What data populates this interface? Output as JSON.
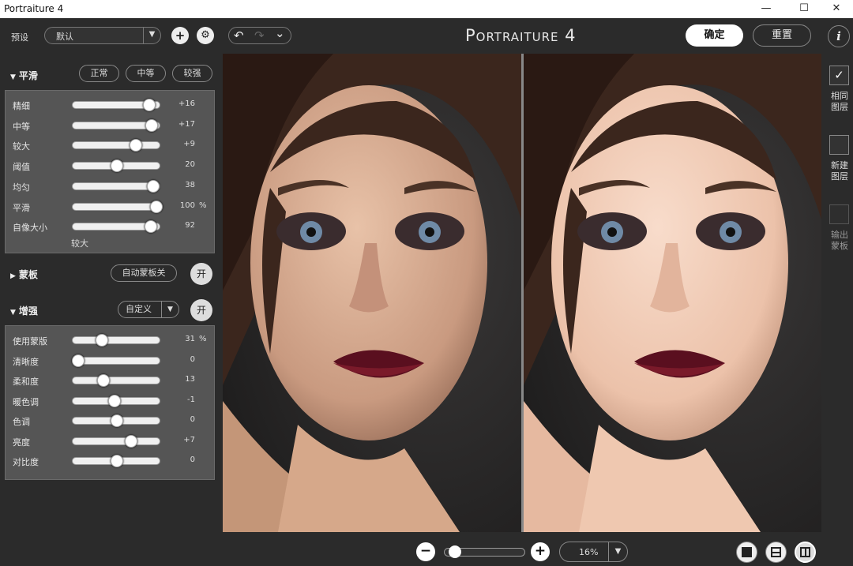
{
  "titlebar": {
    "title": "Portraiture 4",
    "min": "—",
    "max": "☐",
    "close": "✕"
  },
  "toolbar": {
    "preset_label": "预设",
    "preset_value": "默认",
    "add": "+",
    "gear": "⚙",
    "undo": "↶",
    "redo": "↷",
    "history": "⌄",
    "brand": "Portraiture 4",
    "ok": "确定",
    "reset": "重置",
    "info": "i"
  },
  "smoothing": {
    "header": "平滑",
    "arrow": "▼",
    "buttons": [
      "正常",
      "中等",
      "较强"
    ],
    "sliders": [
      {
        "name": "精细",
        "value": "+16",
        "pos": 0.87,
        "unit": ""
      },
      {
        "name": "中等",
        "value": "+17",
        "pos": 0.89,
        "unit": ""
      },
      {
        "name": "较大",
        "value": "+9",
        "pos": 0.71,
        "unit": ""
      },
      {
        "name": "阈值",
        "value": "20",
        "pos": 0.5,
        "unit": ""
      },
      {
        "name": "均匀",
        "value": "38",
        "pos": 0.91,
        "unit": ""
      },
      {
        "name": "平滑",
        "value": "100",
        "pos": 0.95,
        "unit": "%"
      },
      {
        "name": "自像大小",
        "value": "92",
        "pos": 0.88,
        "unit": ""
      }
    ],
    "footer": "较大"
  },
  "mask": {
    "header": "蒙板",
    "arrow": "▶",
    "auto": "自动蒙板关",
    "toggle": "开"
  },
  "enhance": {
    "header": "增强",
    "arrow": "▼",
    "mode": "自定义",
    "dd": "▼",
    "toggle": "开",
    "sliders": [
      {
        "name": "使用蒙版",
        "value": "31",
        "pos": 0.33,
        "unit": "%"
      },
      {
        "name": "清晰度",
        "value": "0",
        "pos": 0.06,
        "unit": ""
      },
      {
        "name": "柔和度",
        "value": "13",
        "pos": 0.35,
        "unit": ""
      },
      {
        "name": "暖色调",
        "value": "-1",
        "pos": 0.47,
        "unit": ""
      },
      {
        "name": "色调",
        "value": "0",
        "pos": 0.5,
        "unit": ""
      },
      {
        "name": "亮度",
        "value": "+7",
        "pos": 0.66,
        "unit": ""
      },
      {
        "name": "对比度",
        "value": "0",
        "pos": 0.5,
        "unit": ""
      }
    ]
  },
  "rightbar": {
    "check": "✓",
    "same_layer": "相同\n图层",
    "new_layer": "新建\n图层",
    "output_mask": "输出\n蒙板"
  },
  "bottom": {
    "zoom_out": "−",
    "zoom_in": "+",
    "zoom_value": "16%",
    "dd": "▼",
    "zoom_level": 0.06
  }
}
